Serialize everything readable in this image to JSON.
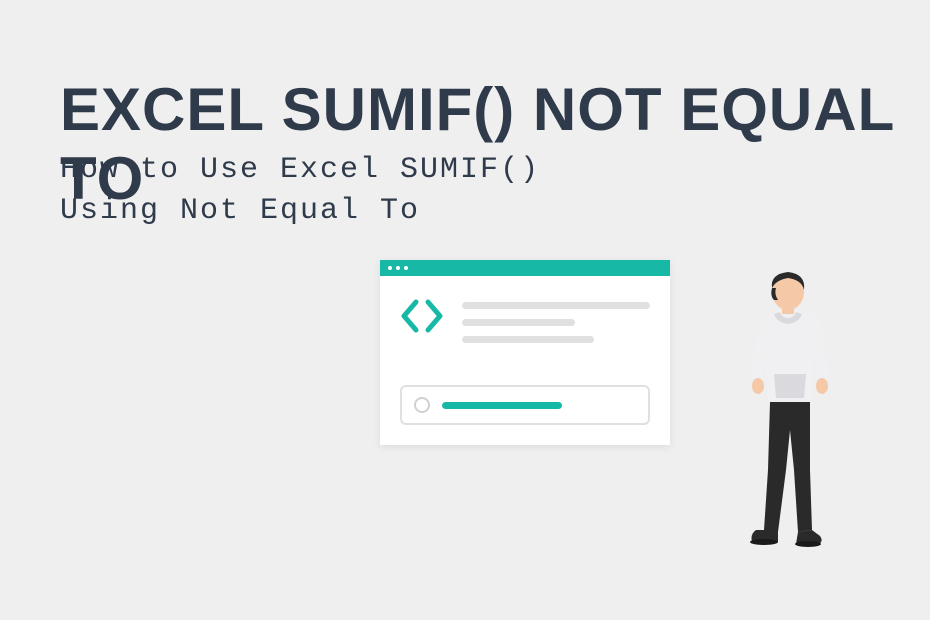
{
  "heading": "EXCEL SUMIF() NOT EQUAL TO",
  "subtitle": "How to Use Excel SUMIF()\nUsing Not Equal To",
  "colors": {
    "background": "#efefef",
    "text": "#2f3a4a",
    "accent": "#17b8a6",
    "lightGray": "#e0e0e0"
  },
  "illustration": {
    "browser_dots": 3,
    "code_symbol": "<>",
    "person_facing": "left"
  }
}
